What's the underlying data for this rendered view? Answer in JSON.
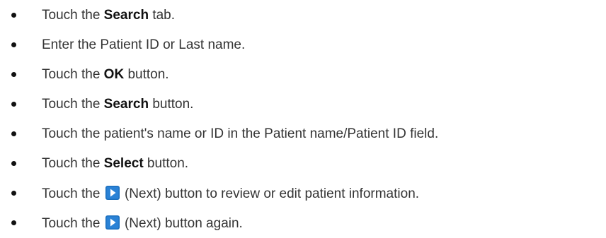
{
  "steps": [
    {
      "pre": "Touch the ",
      "bold": "Search",
      "post": " tab."
    },
    {
      "pre": "Enter the Patient ID or Last name.",
      "bold": "",
      "post": ""
    },
    {
      "pre": "Touch the ",
      "bold": "OK",
      "post": " button."
    },
    {
      "pre": "Touch the ",
      "bold": "Search",
      "post": " button."
    },
    {
      "pre": "Touch the patient's name or ID in the Patient name/Patient ID field.",
      "bold": "",
      "post": ""
    },
    {
      "pre": "Touch the ",
      "bold": "Select",
      "post": " button."
    },
    {
      "pre": "Touch the ",
      "icon": "next-arrow-icon",
      "post": " (Next) button to review or edit patient information."
    },
    {
      "pre": "Touch the ",
      "icon": "next-arrow-icon",
      "post": " (Next) button again."
    }
  ],
  "colors": {
    "text": "#333333",
    "bold": "#111111",
    "icon_bg": "#1b6fbd",
    "icon_fg": "#ffffff"
  }
}
